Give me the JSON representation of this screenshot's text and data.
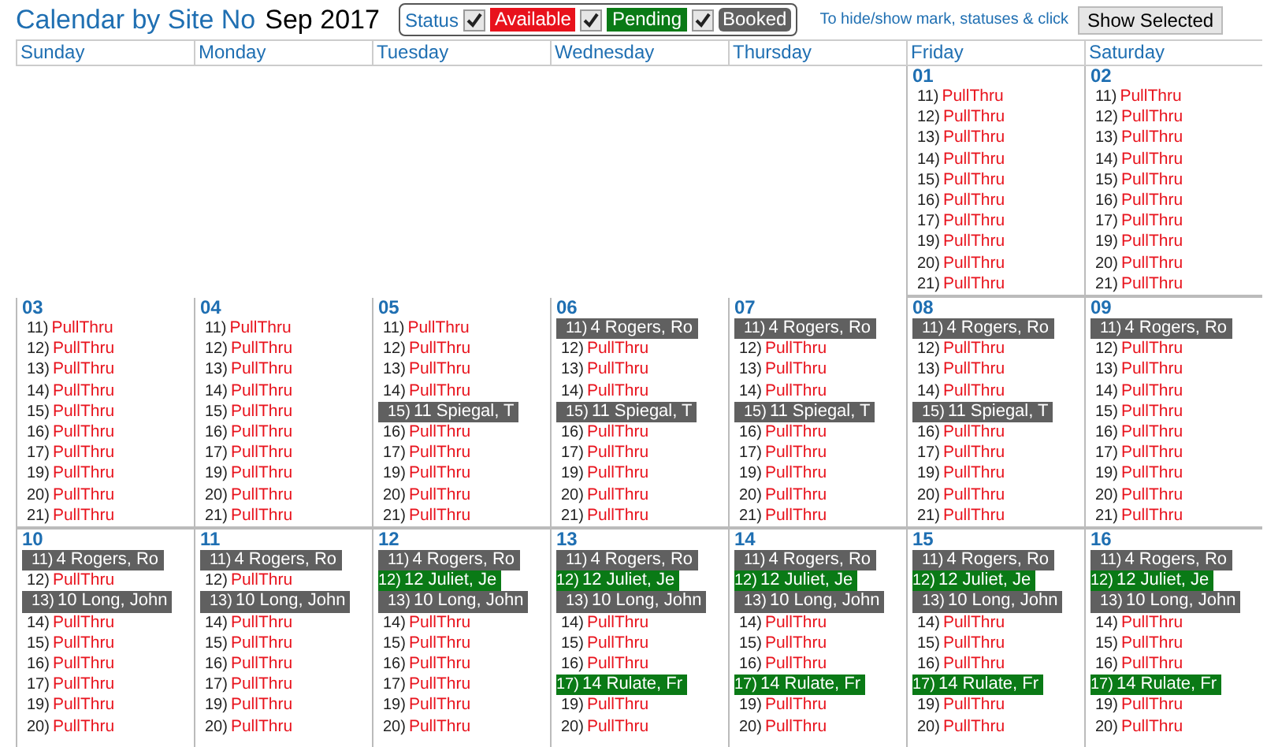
{
  "header": {
    "title": "Calendar by Site No",
    "month": "Sep 2017",
    "status_label": "Status",
    "legend": [
      {
        "label": "Available",
        "kind": "available",
        "checked": true
      },
      {
        "label": "Pending",
        "kind": "pending",
        "checked": true
      },
      {
        "label": "Booked",
        "kind": "booked",
        "checked": true
      }
    ],
    "hint": "To hide/show mark, statuses & click",
    "button": "Show Selected"
  },
  "weekdays": [
    "Sunday",
    "Monday",
    "Tuesday",
    "Wednesday",
    "Thursday",
    "Friday",
    "Saturday"
  ],
  "weeks": [
    {
      "days": [
        {
          "kind": "blank"
        },
        {
          "kind": "blank"
        },
        {
          "kind": "blank"
        },
        {
          "kind": "blank"
        },
        {
          "kind": "blank"
        },
        {
          "kind": "day",
          "date": "01",
          "entries": [
            {
              "kind": "available",
              "site": "11)",
              "label": "PullThru"
            },
            {
              "kind": "available",
              "site": "12)",
              "label": "PullThru"
            },
            {
              "kind": "available",
              "site": "13)",
              "label": "PullThru"
            },
            {
              "kind": "available",
              "site": "14)",
              "label": "PullThru"
            },
            {
              "kind": "available",
              "site": "15)",
              "label": "PullThru"
            },
            {
              "kind": "available",
              "site": "16)",
              "label": "PullThru"
            },
            {
              "kind": "available",
              "site": "17)",
              "label": "PullThru"
            },
            {
              "kind": "available",
              "site": "19)",
              "label": "PullThru"
            },
            {
              "kind": "available",
              "site": "20)",
              "label": "PullThru"
            },
            {
              "kind": "available",
              "site": "21)",
              "label": "PullThru"
            }
          ]
        },
        {
          "kind": "day",
          "date": "02",
          "entries": [
            {
              "kind": "available",
              "site": "11)",
              "label": "PullThru"
            },
            {
              "kind": "available",
              "site": "12)",
              "label": "PullThru"
            },
            {
              "kind": "available",
              "site": "13)",
              "label": "PullThru"
            },
            {
              "kind": "available",
              "site": "14)",
              "label": "PullThru"
            },
            {
              "kind": "available",
              "site": "15)",
              "label": "PullThru"
            },
            {
              "kind": "available",
              "site": "16)",
              "label": "PullThru"
            },
            {
              "kind": "available",
              "site": "17)",
              "label": "PullThru"
            },
            {
              "kind": "available",
              "site": "19)",
              "label": "PullThru"
            },
            {
              "kind": "available",
              "site": "20)",
              "label": "PullThru"
            },
            {
              "kind": "available",
              "site": "21)",
              "label": "PullThru"
            }
          ]
        }
      ]
    },
    {
      "days": [
        {
          "kind": "day",
          "date": "03",
          "entries": [
            {
              "kind": "available",
              "site": "11)",
              "label": "PullThru"
            },
            {
              "kind": "available",
              "site": "12)",
              "label": "PullThru"
            },
            {
              "kind": "available",
              "site": "13)",
              "label": "PullThru"
            },
            {
              "kind": "available",
              "site": "14)",
              "label": "PullThru"
            },
            {
              "kind": "available",
              "site": "15)",
              "label": "PullThru"
            },
            {
              "kind": "available",
              "site": "16)",
              "label": "PullThru"
            },
            {
              "kind": "available",
              "site": "17)",
              "label": "PullThru"
            },
            {
              "kind": "available",
              "site": "19)",
              "label": "PullThru"
            },
            {
              "kind": "available",
              "site": "20)",
              "label": "PullThru"
            },
            {
              "kind": "available",
              "site": "21)",
              "label": "PullThru"
            }
          ]
        },
        {
          "kind": "day",
          "date": "04",
          "entries": [
            {
              "kind": "available",
              "site": "11)",
              "label": "PullThru"
            },
            {
              "kind": "available",
              "site": "12)",
              "label": "PullThru"
            },
            {
              "kind": "available",
              "site": "13)",
              "label": "PullThru"
            },
            {
              "kind": "available",
              "site": "14)",
              "label": "PullThru"
            },
            {
              "kind": "available",
              "site": "15)",
              "label": "PullThru"
            },
            {
              "kind": "available",
              "site": "16)",
              "label": "PullThru"
            },
            {
              "kind": "available",
              "site": "17)",
              "label": "PullThru"
            },
            {
              "kind": "available",
              "site": "19)",
              "label": "PullThru"
            },
            {
              "kind": "available",
              "site": "20)",
              "label": "PullThru"
            },
            {
              "kind": "available",
              "site": "21)",
              "label": "PullThru"
            }
          ]
        },
        {
          "kind": "day",
          "date": "05",
          "entries": [
            {
              "kind": "available",
              "site": "11)",
              "label": "PullThru"
            },
            {
              "kind": "available",
              "site": "12)",
              "label": "PullThru"
            },
            {
              "kind": "available",
              "site": "13)",
              "label": "PullThru"
            },
            {
              "kind": "available",
              "site": "14)",
              "label": "PullThru"
            },
            {
              "kind": "booked",
              "site": "15)",
              "label": "11 Spiegal, T"
            },
            {
              "kind": "available",
              "site": "16)",
              "label": "PullThru"
            },
            {
              "kind": "available",
              "site": "17)",
              "label": "PullThru"
            },
            {
              "kind": "available",
              "site": "19)",
              "label": "PullThru"
            },
            {
              "kind": "available",
              "site": "20)",
              "label": "PullThru"
            },
            {
              "kind": "available",
              "site": "21)",
              "label": "PullThru"
            }
          ]
        },
        {
          "kind": "day",
          "date": "06",
          "entries": [
            {
              "kind": "booked",
              "site": "11)",
              "label": "4 Rogers, Ro"
            },
            {
              "kind": "available",
              "site": "12)",
              "label": "PullThru"
            },
            {
              "kind": "available",
              "site": "13)",
              "label": "PullThru"
            },
            {
              "kind": "available",
              "site": "14)",
              "label": "PullThru"
            },
            {
              "kind": "booked",
              "site": "15)",
              "label": "11 Spiegal, T"
            },
            {
              "kind": "available",
              "site": "16)",
              "label": "PullThru"
            },
            {
              "kind": "available",
              "site": "17)",
              "label": "PullThru"
            },
            {
              "kind": "available",
              "site": "19)",
              "label": "PullThru"
            },
            {
              "kind": "available",
              "site": "20)",
              "label": "PullThru"
            },
            {
              "kind": "available",
              "site": "21)",
              "label": "PullThru"
            }
          ]
        },
        {
          "kind": "day",
          "date": "07",
          "entries": [
            {
              "kind": "booked",
              "site": "11)",
              "label": "4 Rogers, Ro"
            },
            {
              "kind": "available",
              "site": "12)",
              "label": "PullThru"
            },
            {
              "kind": "available",
              "site": "13)",
              "label": "PullThru"
            },
            {
              "kind": "available",
              "site": "14)",
              "label": "PullThru"
            },
            {
              "kind": "booked",
              "site": "15)",
              "label": "11 Spiegal, T"
            },
            {
              "kind": "available",
              "site": "16)",
              "label": "PullThru"
            },
            {
              "kind": "available",
              "site": "17)",
              "label": "PullThru"
            },
            {
              "kind": "available",
              "site": "19)",
              "label": "PullThru"
            },
            {
              "kind": "available",
              "site": "20)",
              "label": "PullThru"
            },
            {
              "kind": "available",
              "site": "21)",
              "label": "PullThru"
            }
          ]
        },
        {
          "kind": "day",
          "date": "08",
          "entries": [
            {
              "kind": "booked",
              "site": "11)",
              "label": "4 Rogers, Ro"
            },
            {
              "kind": "available",
              "site": "12)",
              "label": "PullThru"
            },
            {
              "kind": "available",
              "site": "13)",
              "label": "PullThru"
            },
            {
              "kind": "available",
              "site": "14)",
              "label": "PullThru"
            },
            {
              "kind": "booked",
              "site": "15)",
              "label": "11 Spiegal, T"
            },
            {
              "kind": "available",
              "site": "16)",
              "label": "PullThru"
            },
            {
              "kind": "available",
              "site": "17)",
              "label": "PullThru"
            },
            {
              "kind": "available",
              "site": "19)",
              "label": "PullThru"
            },
            {
              "kind": "available",
              "site": "20)",
              "label": "PullThru"
            },
            {
              "kind": "available",
              "site": "21)",
              "label": "PullThru"
            }
          ]
        },
        {
          "kind": "day",
          "date": "09",
          "entries": [
            {
              "kind": "booked",
              "site": "11)",
              "label": "4 Rogers, Ro"
            },
            {
              "kind": "available",
              "site": "12)",
              "label": "PullThru"
            },
            {
              "kind": "available",
              "site": "13)",
              "label": "PullThru"
            },
            {
              "kind": "available",
              "site": "14)",
              "label": "PullThru"
            },
            {
              "kind": "available",
              "site": "15)",
              "label": "PullThru"
            },
            {
              "kind": "available",
              "site": "16)",
              "label": "PullThru"
            },
            {
              "kind": "available",
              "site": "17)",
              "label": "PullThru"
            },
            {
              "kind": "available",
              "site": "19)",
              "label": "PullThru"
            },
            {
              "kind": "available",
              "site": "20)",
              "label": "PullThru"
            },
            {
              "kind": "available",
              "site": "21)",
              "label": "PullThru"
            }
          ]
        }
      ]
    },
    {
      "days": [
        {
          "kind": "day",
          "date": "10",
          "entries": [
            {
              "kind": "booked",
              "site": "11)",
              "label": "4 Rogers, Ro"
            },
            {
              "kind": "available",
              "site": "12)",
              "label": "PullThru"
            },
            {
              "kind": "booked",
              "site": "13)",
              "label": "10 Long, John"
            },
            {
              "kind": "available",
              "site": "14)",
              "label": "PullThru"
            },
            {
              "kind": "available",
              "site": "15)",
              "label": "PullThru"
            },
            {
              "kind": "available",
              "site": "16)",
              "label": "PullThru"
            },
            {
              "kind": "available",
              "site": "17)",
              "label": "PullThru"
            },
            {
              "kind": "available",
              "site": "19)",
              "label": "PullThru"
            },
            {
              "kind": "available",
              "site": "20)",
              "label": "PullThru"
            }
          ]
        },
        {
          "kind": "day",
          "date": "11",
          "entries": [
            {
              "kind": "booked",
              "site": "11)",
              "label": "4 Rogers, Ro"
            },
            {
              "kind": "available",
              "site": "12)",
              "label": "PullThru"
            },
            {
              "kind": "booked",
              "site": "13)",
              "label": "10 Long, John"
            },
            {
              "kind": "available",
              "site": "14)",
              "label": "PullThru"
            },
            {
              "kind": "available",
              "site": "15)",
              "label": "PullThru"
            },
            {
              "kind": "available",
              "site": "16)",
              "label": "PullThru"
            },
            {
              "kind": "available",
              "site": "17)",
              "label": "PullThru"
            },
            {
              "kind": "available",
              "site": "19)",
              "label": "PullThru"
            },
            {
              "kind": "available",
              "site": "20)",
              "label": "PullThru"
            }
          ]
        },
        {
          "kind": "day",
          "date": "12",
          "entries": [
            {
              "kind": "booked",
              "site": "11)",
              "label": "4 Rogers, Ro"
            },
            {
              "kind": "pending",
              "site": "12)",
              "label": "12 Juliet, Je"
            },
            {
              "kind": "booked",
              "site": "13)",
              "label": "10 Long, John"
            },
            {
              "kind": "available",
              "site": "14)",
              "label": "PullThru"
            },
            {
              "kind": "available",
              "site": "15)",
              "label": "PullThru"
            },
            {
              "kind": "available",
              "site": "16)",
              "label": "PullThru"
            },
            {
              "kind": "available",
              "site": "17)",
              "label": "PullThru"
            },
            {
              "kind": "available",
              "site": "19)",
              "label": "PullThru"
            },
            {
              "kind": "available",
              "site": "20)",
              "label": "PullThru"
            }
          ]
        },
        {
          "kind": "day",
          "date": "13",
          "entries": [
            {
              "kind": "booked",
              "site": "11)",
              "label": "4 Rogers, Ro"
            },
            {
              "kind": "pending",
              "site": "12)",
              "label": "12 Juliet, Je"
            },
            {
              "kind": "booked",
              "site": "13)",
              "label": "10 Long, John"
            },
            {
              "kind": "available",
              "site": "14)",
              "label": "PullThru"
            },
            {
              "kind": "available",
              "site": "15)",
              "label": "PullThru"
            },
            {
              "kind": "available",
              "site": "16)",
              "label": "PullThru"
            },
            {
              "kind": "pending",
              "site": "17)",
              "label": "14 Rulate, Fr"
            },
            {
              "kind": "available",
              "site": "19)",
              "label": "PullThru"
            },
            {
              "kind": "available",
              "site": "20)",
              "label": "PullThru"
            }
          ]
        },
        {
          "kind": "day",
          "date": "14",
          "entries": [
            {
              "kind": "booked",
              "site": "11)",
              "label": "4 Rogers, Ro"
            },
            {
              "kind": "pending",
              "site": "12)",
              "label": "12 Juliet, Je"
            },
            {
              "kind": "booked",
              "site": "13)",
              "label": "10 Long, John"
            },
            {
              "kind": "available",
              "site": "14)",
              "label": "PullThru"
            },
            {
              "kind": "available",
              "site": "15)",
              "label": "PullThru"
            },
            {
              "kind": "available",
              "site": "16)",
              "label": "PullThru"
            },
            {
              "kind": "pending",
              "site": "17)",
              "label": "14 Rulate, Fr"
            },
            {
              "kind": "available",
              "site": "19)",
              "label": "PullThru"
            },
            {
              "kind": "available",
              "site": "20)",
              "label": "PullThru"
            }
          ]
        },
        {
          "kind": "day",
          "date": "15",
          "entries": [
            {
              "kind": "booked",
              "site": "11)",
              "label": "4 Rogers, Ro"
            },
            {
              "kind": "pending",
              "site": "12)",
              "label": "12 Juliet, Je"
            },
            {
              "kind": "booked",
              "site": "13)",
              "label": "10 Long, John"
            },
            {
              "kind": "available",
              "site": "14)",
              "label": "PullThru"
            },
            {
              "kind": "available",
              "site": "15)",
              "label": "PullThru"
            },
            {
              "kind": "available",
              "site": "16)",
              "label": "PullThru"
            },
            {
              "kind": "pending",
              "site": "17)",
              "label": "14 Rulate, Fr"
            },
            {
              "kind": "available",
              "site": "19)",
              "label": "PullThru"
            },
            {
              "kind": "available",
              "site": "20)",
              "label": "PullThru"
            }
          ]
        },
        {
          "kind": "day",
          "date": "16",
          "entries": [
            {
              "kind": "booked",
              "site": "11)",
              "label": "4 Rogers, Ro"
            },
            {
              "kind": "pending",
              "site": "12)",
              "label": "12 Juliet, Je"
            },
            {
              "kind": "booked",
              "site": "13)",
              "label": "10 Long, John"
            },
            {
              "kind": "available",
              "site": "14)",
              "label": "PullThru"
            },
            {
              "kind": "available",
              "site": "15)",
              "label": "PullThru"
            },
            {
              "kind": "available",
              "site": "16)",
              "label": "PullThru"
            },
            {
              "kind": "pending",
              "site": "17)",
              "label": "14 Rulate, Fr"
            },
            {
              "kind": "available",
              "site": "19)",
              "label": "PullThru"
            },
            {
              "kind": "available",
              "site": "20)",
              "label": "PullThru"
            }
          ]
        }
      ]
    }
  ]
}
